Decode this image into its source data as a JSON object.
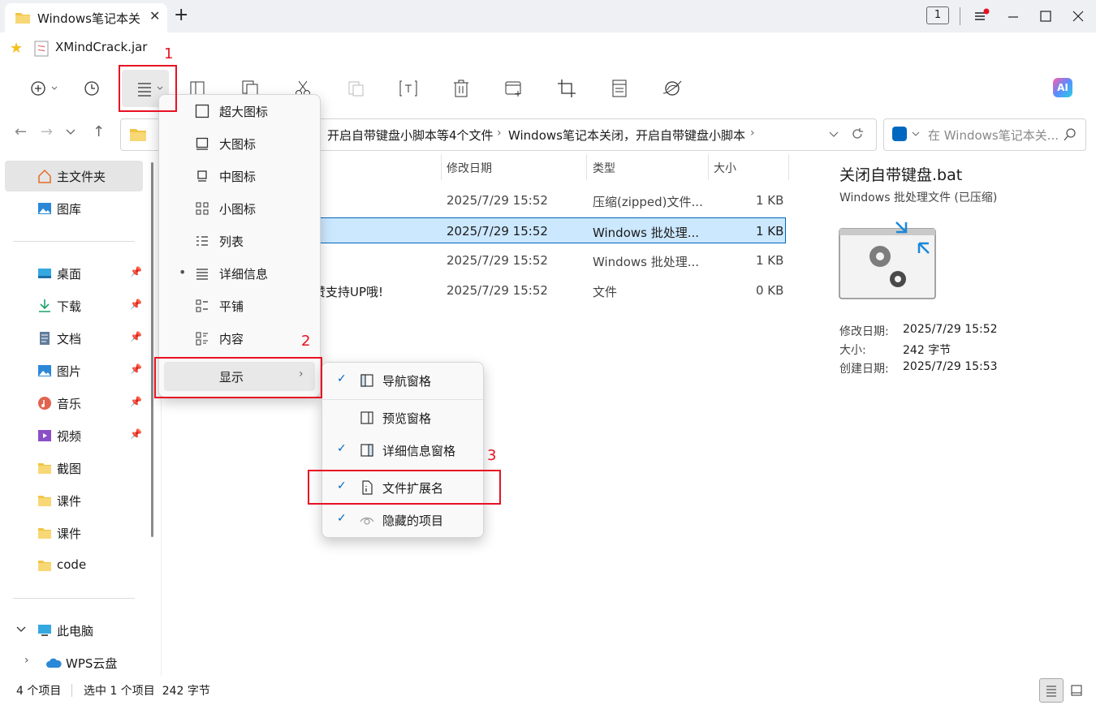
{
  "window": {
    "tab_title": "Windows笔记本关",
    "badge": "1",
    "close_glyph": "✕",
    "newtab_glyph": "+"
  },
  "bookmarks": [
    {
      "label": "XMindCrack.jar"
    }
  ],
  "toolbar": {
    "icons": [
      "new-icon",
      "history-icon",
      "view-menu-icon",
      "open-icon",
      "copy-icon",
      "cut-icon",
      "paste-icon",
      "rename-icon",
      "delete-icon",
      "new-tab-icon",
      "crop-icon",
      "properties-icon",
      "share-icon",
      "ai-icon"
    ],
    "ai_label": "AI"
  },
  "address": {
    "path": [
      "开启自带键盘小脚本等4个文件",
      "Windows笔记本关闭，开启自带键盘小脚本"
    ],
    "search_placeholder": "在 Windows笔记本关..."
  },
  "sidebar": {
    "top": [
      {
        "label": "主文件夹",
        "icon": "home-icon"
      },
      {
        "label": "图库",
        "icon": "gallery-icon"
      }
    ],
    "quick": [
      {
        "label": "桌面",
        "icon": "desktop-icon",
        "pinned": true
      },
      {
        "label": "下载",
        "icon": "download-icon",
        "pinned": true
      },
      {
        "label": "文档",
        "icon": "document-icon",
        "pinned": true
      },
      {
        "label": "图片",
        "icon": "pictures-icon",
        "pinned": true
      },
      {
        "label": "音乐",
        "icon": "music-icon",
        "pinned": true
      },
      {
        "label": "视频",
        "icon": "video-icon",
        "pinned": true
      },
      {
        "label": "截图",
        "icon": "folder-icon",
        "pinned": false
      },
      {
        "label": "课件",
        "icon": "folder-icon",
        "pinned": false
      },
      {
        "label": "课件",
        "icon": "folder-icon",
        "pinned": false
      },
      {
        "label": "code",
        "icon": "folder-icon",
        "pinned": false
      }
    ],
    "pc": [
      {
        "label": "此电脑",
        "icon": "computer-icon"
      },
      {
        "label": "WPS云盘",
        "icon": "cloud-icon"
      }
    ]
  },
  "columns": {
    "date": "修改日期",
    "type": "类型",
    "size": "大小"
  },
  "files": [
    {
      "name": "",
      "date": "2025/7/29 15:52",
      "type": "压缩(zipped)文件...",
      "size": "1 KB",
      "selected": false
    },
    {
      "name": "",
      "date": "2025/7/29 15:52",
      "type": "Windows 批处理...",
      "size": "1 KB",
      "selected": true
    },
    {
      "name": "",
      "date": "2025/7/29 15:52",
      "type": "Windows 批处理...",
      "size": "1 KB",
      "selected": false
    },
    {
      "name": "赞支持UP哦!",
      "date": "2025/7/29 15:52",
      "type": "文件",
      "size": "0 KB",
      "selected": false
    }
  ],
  "details": {
    "title": "关闭自带键盘.bat",
    "subtitle": "Windows 批处理文件 (已压缩)",
    "props": [
      {
        "label": "修改日期:",
        "value": "2025/7/29 15:52"
      },
      {
        "label": "大小:",
        "value": "242 字节"
      },
      {
        "label": "创建日期:",
        "value": "2025/7/29 15:53"
      }
    ]
  },
  "view_menu": [
    {
      "label": "超大图标",
      "icon": "extra-large-icons-icon",
      "active": false
    },
    {
      "label": "大图标",
      "icon": "large-icons-icon",
      "active": false
    },
    {
      "label": "中图标",
      "icon": "medium-icons-icon",
      "active": false
    },
    {
      "label": "小图标",
      "icon": "small-icons-icon",
      "active": false
    },
    {
      "label": "列表",
      "icon": "list-icon",
      "active": false
    },
    {
      "label": "详细信息",
      "icon": "details-icon",
      "active": true
    },
    {
      "label": "平铺",
      "icon": "tiles-icon",
      "active": false
    },
    {
      "label": "内容",
      "icon": "content-icon",
      "active": false
    }
  ],
  "show_item": {
    "label": "显示"
  },
  "show_menu": [
    {
      "label": "导航窗格",
      "icon": "nav-pane-icon",
      "checked": true
    },
    {
      "label": "预览窗格",
      "icon": "preview-pane-icon",
      "checked": false
    },
    {
      "label": "详细信息窗格",
      "icon": "details-pane-icon",
      "checked": true
    },
    {
      "label": "文件扩展名",
      "icon": "file-ext-icon",
      "checked": true
    },
    {
      "label": "隐藏的项目",
      "icon": "hidden-items-icon",
      "checked": true
    }
  ],
  "status": {
    "count": "4 个项目",
    "selection": "选中 1 个项目  242 字节"
  },
  "annotations": [
    "1",
    "2",
    "3"
  ],
  "colors": {
    "accent": "#0067c0",
    "selection": "#cce8ff",
    "annotation": "#e81123"
  }
}
